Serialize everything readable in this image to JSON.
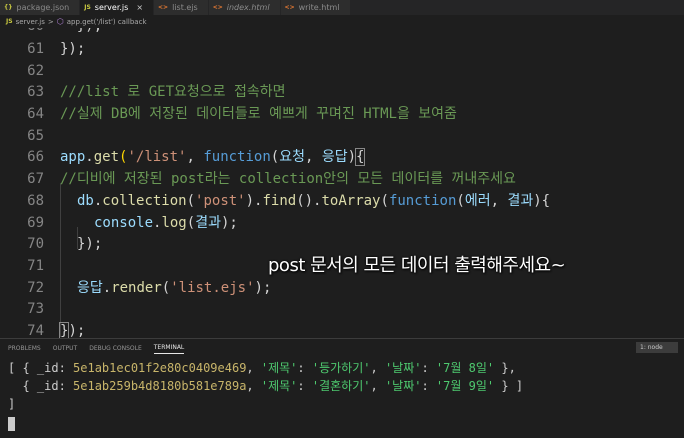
{
  "tabs": [
    {
      "icon": "{}",
      "label": "package.json",
      "active": false
    },
    {
      "icon": "JS",
      "label": "server.js",
      "active": true,
      "close": "×"
    },
    {
      "icon": "<>",
      "label": "list.ejs",
      "active": false
    },
    {
      "icon": "<>",
      "label": "index.html",
      "active": false
    },
    {
      "icon": "<>",
      "label": "write.html",
      "active": false
    }
  ],
  "breadcrumb": {
    "file_icon": "JS",
    "file": "server.js",
    "sep": ">",
    "symbol": "app.get('/list') callback"
  },
  "code": {
    "line60": {
      "num": "60",
      "text": "  });"
    },
    "line61": {
      "num": "61",
      "text": "});"
    },
    "line62": {
      "num": "62"
    },
    "line63": {
      "num": "63",
      "comment": "///list 로 GET요청으로 접속하면"
    },
    "line64": {
      "num": "64",
      "comment": "//실제 DB에 저장된 데이터들로 예쁘게 꾸며진 HTML을 보여줌"
    },
    "line65": {
      "num": "65"
    },
    "line66": {
      "num": "66",
      "obj": "app",
      "dot": ".",
      "fn": "get",
      "open": "(",
      "str": "'/list'",
      "comma": ", ",
      "kw": "function",
      "params_open": "(",
      "p1": "요청",
      "sep": ", ",
      "p2": "응답",
      "params_close": ")",
      "brace": "{"
    },
    "line67": {
      "num": "67",
      "comment": "//디비에 저장된 post라는 collection안의 모든 데이터를 꺼내주세요"
    },
    "line68": {
      "num": "68",
      "obj": "db",
      "dot1": ".",
      "fn1": "collection",
      "open1": "(",
      "str": "'post'",
      "close1": ").",
      "fn2": "find",
      "mid": "().",
      "fn3": "toArray",
      "open2": "(",
      "kw": "function",
      "open3": "(",
      "p1": "에러",
      "sep": ", ",
      "p2": "결과",
      "close3": "){"
    },
    "line69": {
      "num": "69",
      "obj": "console",
      "dot": ".",
      "fn": "log",
      "open": "(",
      "arg": "결과",
      "close": ");"
    },
    "line70": {
      "num": "70",
      "text": "});"
    },
    "line71": {
      "num": "71"
    },
    "line72": {
      "num": "72",
      "obj": "응답",
      "dot": ".",
      "fn": "render",
      "open": "(",
      "str": "'list.ejs'",
      "close": ");"
    },
    "line73": {
      "num": "73"
    },
    "line74": {
      "num": "74",
      "brace": "}",
      "rest": ");"
    }
  },
  "overlay_text": "post 문서의 모든 데이터 출력해주세요~",
  "panel": {
    "tabs": [
      "PROBLEMS",
      "OUTPUT",
      "DEBUG CONSOLE",
      "TERMINAL"
    ],
    "terminal_select": "1: node",
    "rows": [
      {
        "open": "[ { _id: ",
        "id": "5e1ab1ec01f2e80c0409e469",
        "k1": "'제목'",
        "v1": "'등가하기'",
        "k2": "'날짜'",
        "v2": "'7월 8일'",
        "end": " },"
      },
      {
        "open": "  { _id: ",
        "id": "5e1ab259b4d8180b581e789a",
        "k1": "'제목'",
        "v1": "'결혼하기'",
        "k2": "'날짜'",
        "v2": "'7월 9일'",
        "end": " } ]"
      }
    ],
    "prompt_line": "]"
  },
  "colors": {
    "background": "#1e1e1e",
    "comment": "#6a9955",
    "keyword": "#569cd6",
    "string": "#ce9178",
    "function": "#dcdcaa",
    "variable": "#9cdcfe"
  }
}
